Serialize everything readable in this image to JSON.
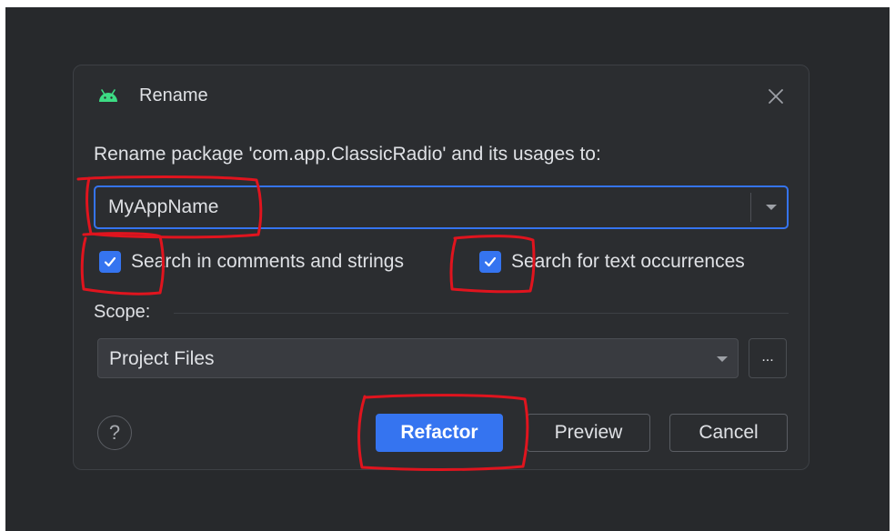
{
  "dialog": {
    "title": "Rename",
    "icon": "android-icon",
    "prompt": "Rename package 'com.app.ClassicRadio' and its usages to:",
    "new_name": {
      "value": "MyAppName"
    },
    "options": {
      "search_comments": {
        "label": "Search in comments and strings",
        "checked": true
      },
      "search_text": {
        "label": "Search for text occurrences",
        "checked": true
      }
    },
    "scope": {
      "label": "Scope:",
      "value": "Project Files",
      "browse_label": "..."
    },
    "buttons": {
      "help": "?",
      "refactor": "Refactor",
      "preview": "Preview",
      "cancel": "Cancel"
    }
  },
  "colors": {
    "accent": "#3574f0",
    "dialog_bg": "#2b2d30",
    "backdrop": "#27292c",
    "text": "#dfe1e5",
    "annotation": "#e0141e",
    "android": "#3ddc84"
  }
}
